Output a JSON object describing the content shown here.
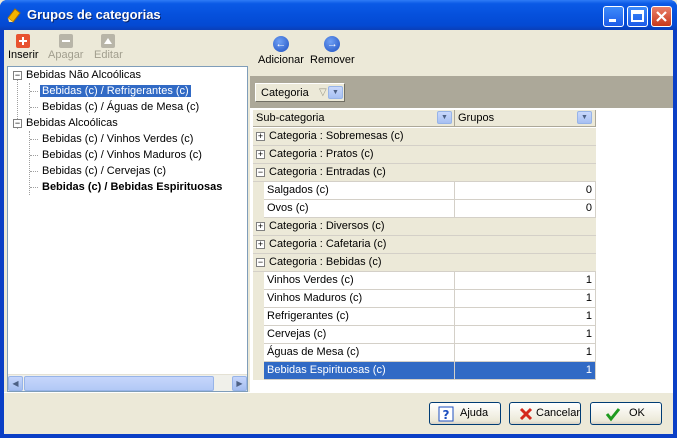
{
  "window": {
    "title": "Grupos de categorias"
  },
  "left_toolbar": {
    "insert": "Inserir",
    "delete": "Apagar",
    "edit": "Editar"
  },
  "tree": {
    "groups": [
      {
        "label": "Bebidas Não Alcoólicas",
        "children": [
          "Bebidas (c)  /  Refrigerantes (c)",
          "Bebidas (c)  /  Águas de Mesa (c)"
        ]
      },
      {
        "label": "Bebidas Alcoólicas",
        "children": [
          "Bebidas (c)  /  Vinhos Verdes (c)",
          "Bebidas (c)  /  Vinhos Maduros (c)",
          "Bebidas (c)  /  Cervejas (c)",
          "Bebidas (c)  /  Bebidas Espirituosas"
        ]
      }
    ],
    "selected": "Bebidas (c)  /  Refrigerantes (c)"
  },
  "right_toolbar": {
    "add": "Adicionar",
    "remove": "Remover"
  },
  "group_panel": {
    "chip_label": "Categoria"
  },
  "grid": {
    "columns": [
      "Sub-categoria",
      "Grupos"
    ],
    "group_rows": [
      {
        "label": "Categoria : Sobremesas (c)",
        "expanded": false
      },
      {
        "label": "Categoria : Pratos (c)",
        "expanded": false
      },
      {
        "label": "Categoria : Entradas (c)",
        "expanded": true,
        "rows": [
          [
            "Salgados (c)",
            "0"
          ],
          [
            "Ovos (c)",
            "0"
          ]
        ]
      },
      {
        "label": "Categoria : Diversos (c)",
        "expanded": false
      },
      {
        "label": "Categoria : Cafetaria (c)",
        "expanded": false
      },
      {
        "label": "Categoria : Bebidas (c)",
        "expanded": true,
        "rows": [
          [
            "Vinhos Verdes (c)",
            "1"
          ],
          [
            "Vinhos Maduros (c)",
            "1"
          ],
          [
            "Refrigerantes (c)",
            "1"
          ],
          [
            "Cervejas (c)",
            "1"
          ],
          [
            "Águas de Mesa (c)",
            "1"
          ],
          [
            "Bebidas Espirituosas (c)",
            "1"
          ]
        ]
      }
    ]
  },
  "buttons": {
    "help": "Ajuda",
    "cancel": "Cancelar",
    "ok": "OK"
  },
  "colors": {
    "title_bar": "#0550dc",
    "selection": "#316ac5",
    "panel": "#ece9d8",
    "group_panel": "#aca899"
  }
}
